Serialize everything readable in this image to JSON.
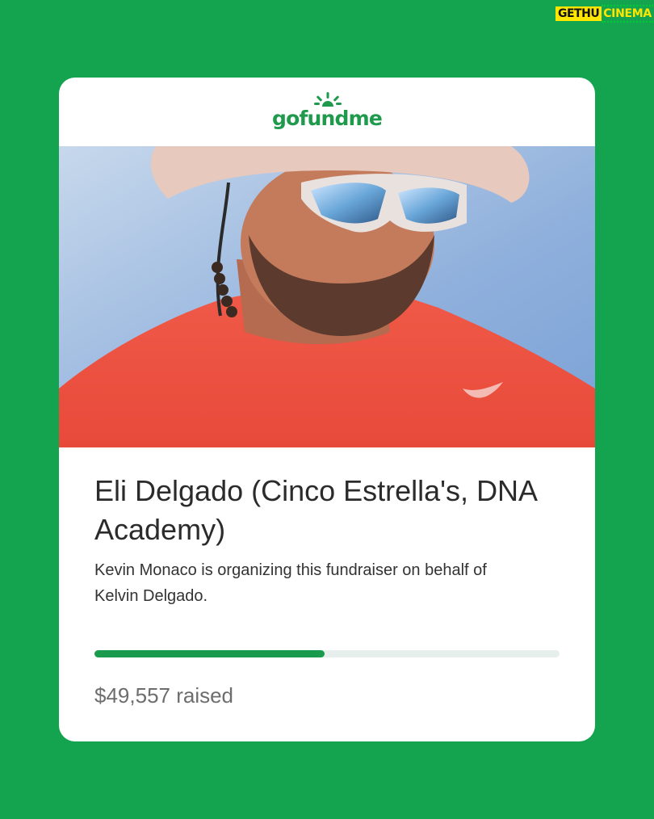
{
  "watermark": {
    "left": "GETHU",
    "right": "CINEMA"
  },
  "card": {
    "logo_text": "gofundme",
    "photo_icon": "photo-image",
    "title": "Eli Delgado (Cinco Estrella's, DNA Academy)",
    "subtitle": "Kevin Monaco is organizing this fundraiser on behalf of Kelvin Delgado.",
    "raised": "$49,557 raised",
    "progress": 0.495
  },
  "colors": {
    "background": "#14a34f",
    "brand": "#1f9a4d",
    "progress_fill": "#1a9a4c",
    "progress_track": "#e7efec"
  }
}
